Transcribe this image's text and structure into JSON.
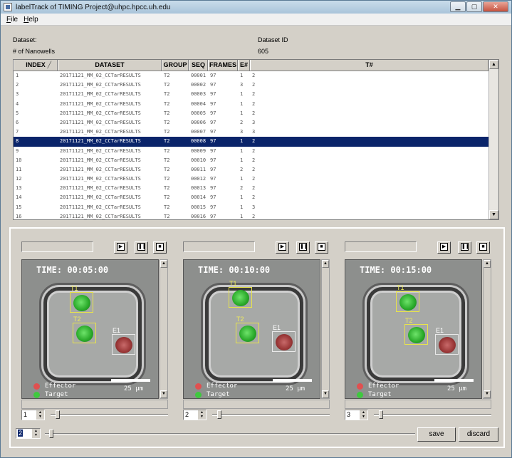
{
  "window": {
    "title": "labelTrack of TIMING Project@uhpc.hpcc.uh.edu"
  },
  "menu": [
    "File",
    "Help"
  ],
  "info": {
    "dataset_label": "Dataset:",
    "nanowells_label": "# of Nanowells",
    "dataset_id_label": "Dataset ID",
    "dataset_id_value": "605"
  },
  "table": {
    "columns": [
      "INDEX",
      "DATASET",
      "GROUP",
      "SEQ",
      "FRAMES",
      "E#",
      "T#"
    ],
    "selected_index": 7,
    "rows": [
      [
        "1",
        "20171121_MM_02_CCTarRESULTS",
        "T2",
        "00001",
        "97",
        "1",
        "2"
      ],
      [
        "2",
        "20171121_MM_02_CCTarRESULTS",
        "T2",
        "00002",
        "97",
        "3",
        "2"
      ],
      [
        "3",
        "20171121_MM_02_CCTarRESULTS",
        "T2",
        "00003",
        "97",
        "1",
        "2"
      ],
      [
        "4",
        "20171121_MM_02_CCTarRESULTS",
        "T2",
        "00004",
        "97",
        "1",
        "2"
      ],
      [
        "5",
        "20171121_MM_02_CCTarRESULTS",
        "T2",
        "00005",
        "97",
        "1",
        "2"
      ],
      [
        "6",
        "20171121_MM_02_CCTarRESULTS",
        "T2",
        "00006",
        "97",
        "2",
        "3"
      ],
      [
        "7",
        "20171121_MM_02_CCTarRESULTS",
        "T2",
        "00007",
        "97",
        "3",
        "3"
      ],
      [
        "8",
        "20171121_MM_02_CCTarRESULTS",
        "T2",
        "00008",
        "97",
        "1",
        "2"
      ],
      [
        "9",
        "20171121_MM_02_CCTarRESULTS",
        "T2",
        "00009",
        "97",
        "1",
        "2"
      ],
      [
        "10",
        "20171121_MM_02_CCTarRESULTS",
        "T2",
        "00010",
        "97",
        "1",
        "2"
      ],
      [
        "11",
        "20171121_MM_02_CCTarRESULTS",
        "T2",
        "00011",
        "97",
        "2",
        "2"
      ],
      [
        "12",
        "20171121_MM_02_CCTarRESULTS",
        "T2",
        "00012",
        "97",
        "1",
        "2"
      ],
      [
        "13",
        "20171121_MM_02_CCTarRESULTS",
        "T2",
        "00013",
        "97",
        "2",
        "2"
      ],
      [
        "14",
        "20171121_MM_02_CCTarRESULTS",
        "T2",
        "00014",
        "97",
        "1",
        "2"
      ],
      [
        "15",
        "20171121_MM_02_CCTarRESULTS",
        "T2",
        "00015",
        "97",
        "1",
        "3"
      ],
      [
        "16",
        "20171121_MM_02_CCTarRESULTS",
        "T2",
        "00016",
        "97",
        "1",
        "2"
      ]
    ]
  },
  "panes": [
    {
      "time": "TIME: 00:05:00",
      "frame": "1",
      "cells": [
        "T1",
        "T2",
        "E1"
      ]
    },
    {
      "time": "TIME: 00:10:00",
      "frame": "2",
      "cells": [
        "T1",
        "T2",
        "E1"
      ]
    },
    {
      "time": "TIME: 00:15:00",
      "frame": "3",
      "cells": [
        "T1",
        "T2",
        "E1"
      ]
    }
  ],
  "legend": {
    "effector": "Effector",
    "target": "Target",
    "scale": "25 µm"
  },
  "colors": {
    "effector": "#e05050",
    "target": "#3ec93e",
    "selection": "#0a246a"
  },
  "bottom": {
    "step_value": "2",
    "save_label": "save",
    "discard_label": "discard"
  },
  "icons": {
    "play": "play-icon",
    "pause": "pause-icon",
    "stop": "stop-icon"
  }
}
